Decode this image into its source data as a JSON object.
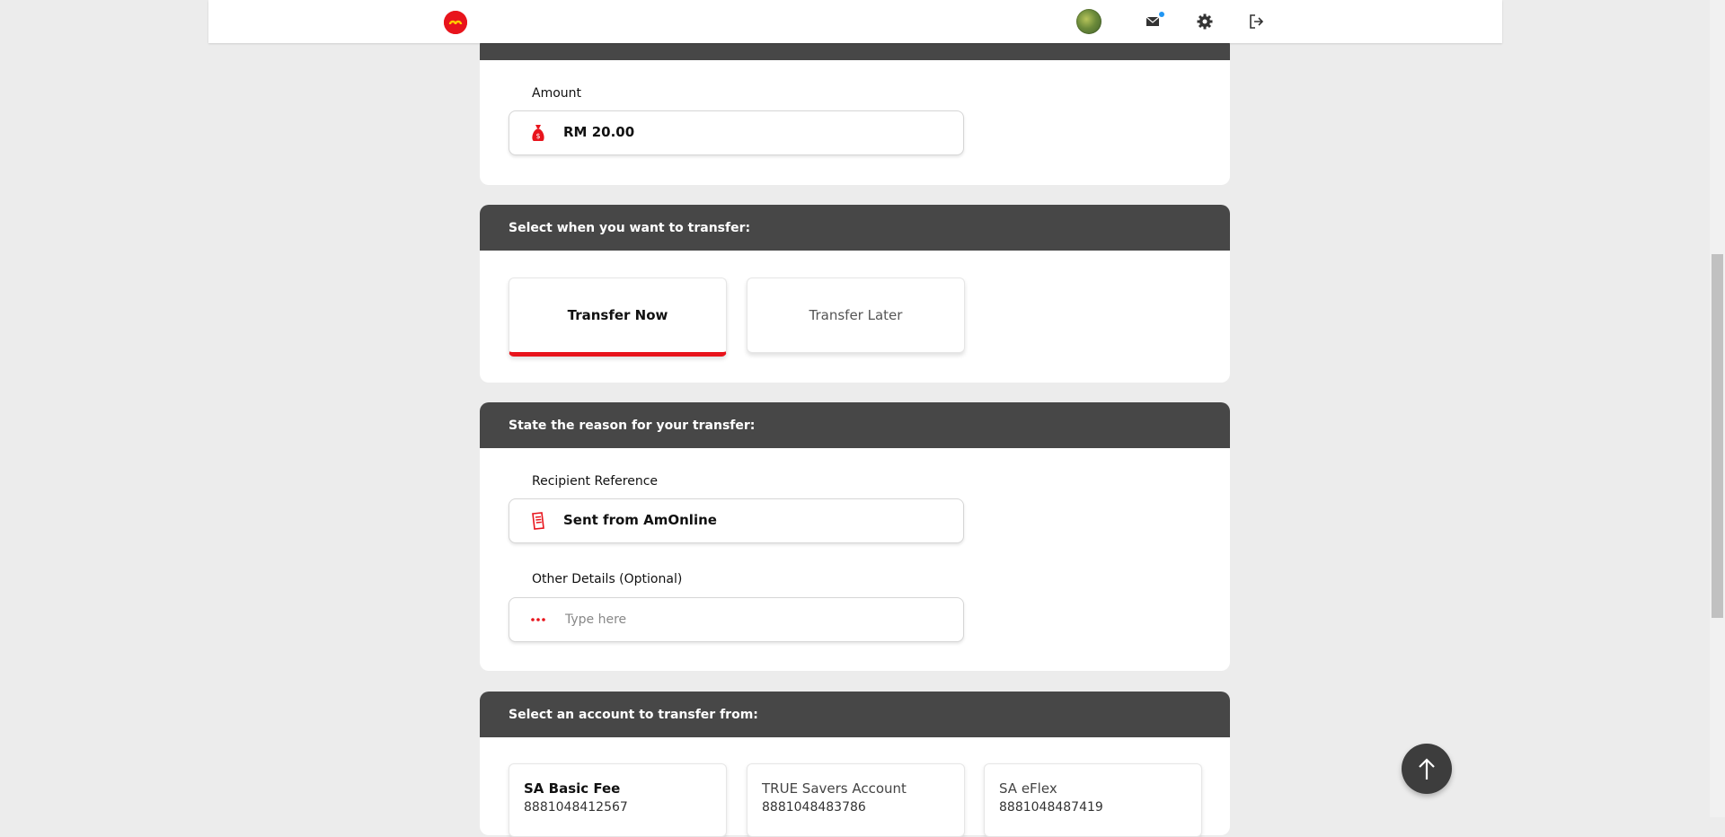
{
  "header": {
    "logo": "amonline-logo",
    "icons": [
      "avatar",
      "mail-icon",
      "gear-icon",
      "logout-icon"
    ]
  },
  "amount_section": {
    "label": "Amount",
    "value": "RM 20.00",
    "icon": "money-bag-icon"
  },
  "transfer_timing": {
    "heading": "Select when you want to transfer:",
    "options": [
      {
        "label": "Transfer Now",
        "selected": true
      },
      {
        "label": "Transfer Later",
        "selected": false
      }
    ]
  },
  "reason_section": {
    "heading": "State the reason for your transfer:",
    "recipient_reference": {
      "label": "Recipient Reference",
      "value": "Sent from AmOnline",
      "icon": "receipt-icon"
    },
    "other_details": {
      "label": "Other Details (Optional)",
      "placeholder": "Type here",
      "icon": "more-dots-icon"
    }
  },
  "account_section": {
    "heading": "Select an account to transfer from:",
    "accounts": [
      {
        "name": "SA Basic Fee",
        "number": "8881048412567",
        "selected": true
      },
      {
        "name": "TRUE Savers Account",
        "number": "8881048483786",
        "selected": false
      },
      {
        "name": "SA eFlex",
        "number": "8881048487419",
        "selected": false
      }
    ]
  },
  "colors": {
    "accent": "#e8141c",
    "header_bar": "#474747",
    "background": "#ececec"
  }
}
